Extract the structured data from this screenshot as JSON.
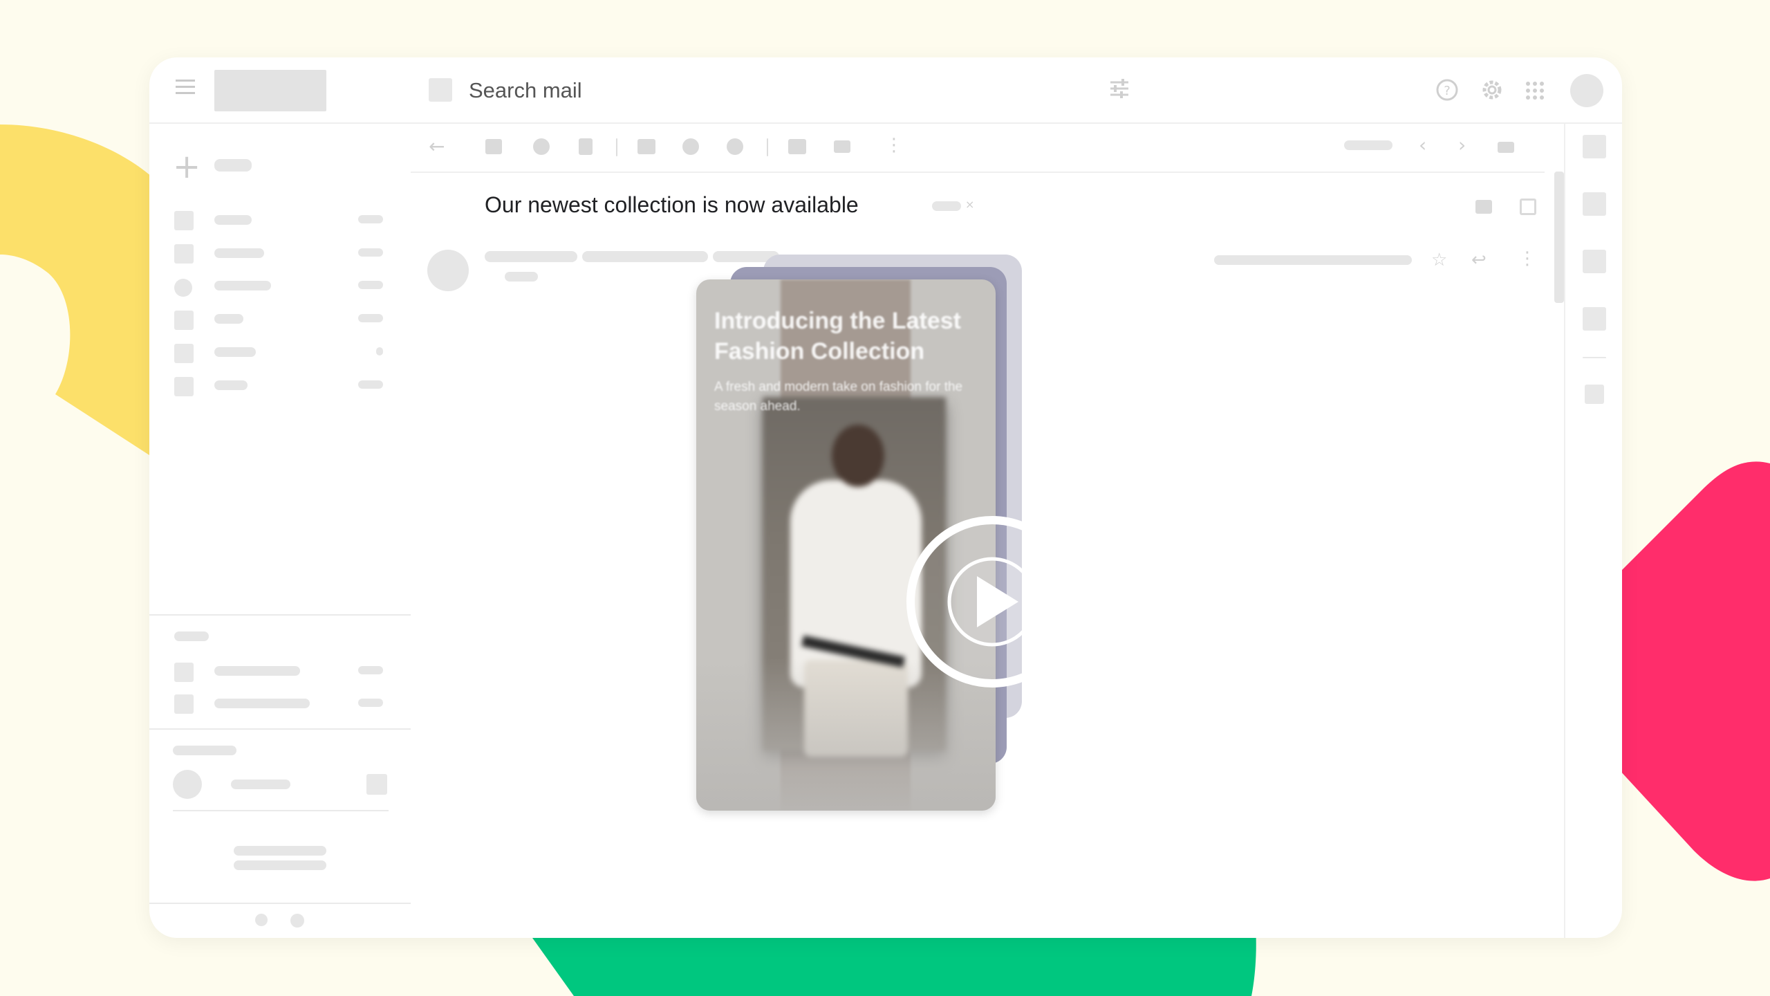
{
  "search": {
    "label": "Search mail"
  },
  "email": {
    "subject": "Our newest collection is now available"
  },
  "promo_card": {
    "title": "Introducing the Latest Fashion Collection",
    "subtitle": "A fresh and modern take on fashion for the season ahead."
  },
  "icons": {
    "menu": "menu-icon",
    "filter": "tune-icon",
    "help": "help-icon",
    "settings": "gear-icon",
    "apps": "apps-grid-icon",
    "compose": "plus-icon",
    "back": "arrow-left-icon",
    "play": "play-icon"
  },
  "colors": {
    "background": "#FEFCEE",
    "blob_yellow": "#FCE06A",
    "blob_pink": "#FF2D6B",
    "blob_green": "#00C77F",
    "card_back1": "#9C9CB6",
    "card_back2": "#D4D4DE"
  }
}
